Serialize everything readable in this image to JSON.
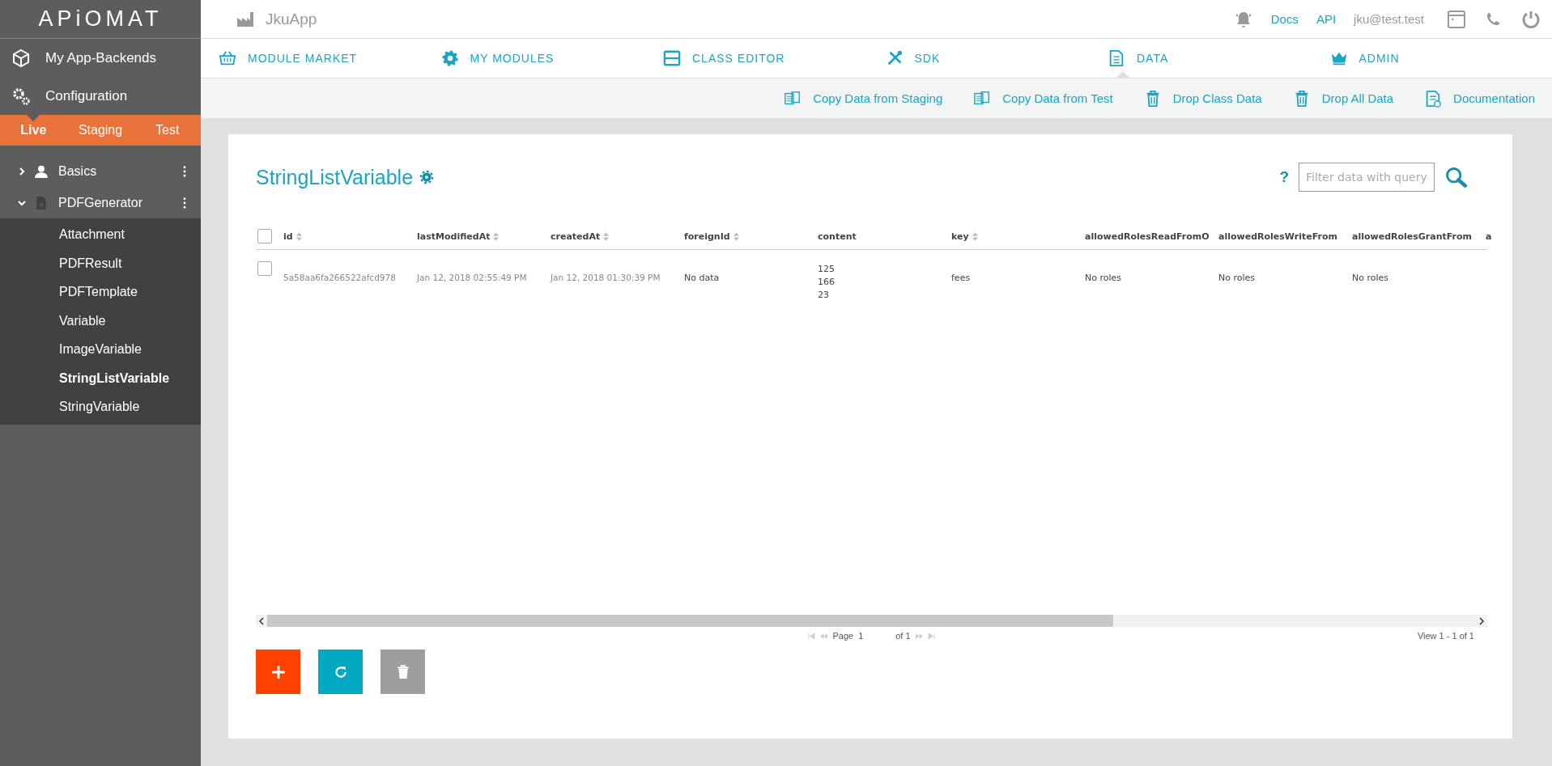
{
  "header": {
    "logo": "APiOMAT",
    "app_name": "JkuApp",
    "links": [
      "Docs",
      "API"
    ],
    "user": "jku@test.test"
  },
  "sidebar": {
    "items": [
      "My App-Backends",
      "Configuration"
    ],
    "environments": [
      {
        "label": "Live",
        "selected": true
      },
      {
        "label": "Staging",
        "selected": false
      },
      {
        "label": "Test",
        "selected": false
      }
    ],
    "modules": [
      {
        "name": "Basics",
        "expanded": false
      },
      {
        "name": "PDFGenerator",
        "expanded": true,
        "children": [
          {
            "name": "Attachment",
            "selected": false
          },
          {
            "name": "PDFResult",
            "selected": false
          },
          {
            "name": "PDFTemplate",
            "selected": false
          },
          {
            "name": "Variable",
            "selected": false
          },
          {
            "name": "ImageVariable",
            "selected": false
          },
          {
            "name": "StringListVariable",
            "selected": true
          },
          {
            "name": "StringVariable",
            "selected": false
          }
        ]
      }
    ]
  },
  "nav_tabs": [
    {
      "label": "MODULE MARKET",
      "selected": false
    },
    {
      "label": "MY MODULES",
      "selected": false
    },
    {
      "label": "CLASS EDITOR",
      "selected": false
    },
    {
      "label": "SDK",
      "selected": false
    },
    {
      "label": "DATA",
      "selected": true
    },
    {
      "label": "ADMIN",
      "selected": false
    }
  ],
  "actions": [
    "Copy Data from Staging",
    "Copy Data from Test",
    "Drop Class Data",
    "Drop All Data",
    "Documentation"
  ],
  "page": {
    "title": "StringListVariable",
    "help": "?",
    "filter": {
      "placeholder": "Filter data with query"
    }
  },
  "table": {
    "all_checked": false,
    "columns": [
      {
        "label": "id",
        "sortable": true
      },
      {
        "label": "lastModifiedAt",
        "sortable": true
      },
      {
        "label": "createdAt",
        "sortable": true
      },
      {
        "label": "foreignId",
        "sortable": true
      },
      {
        "label": "content",
        "sortable": false
      },
      {
        "label": "key",
        "sortable": true
      },
      {
        "label": "allowedRolesReadFromO",
        "sortable": false
      },
      {
        "label": "allowedRolesWriteFrom",
        "sortable": false
      },
      {
        "label": "allowedRolesGrantFrom",
        "sortable": false
      },
      {
        "label": "a",
        "sortable": false
      }
    ],
    "rows": [
      {
        "checked": false,
        "cells": [
          "5a58aa6fa266522afcd978",
          "Jan 12, 2018 02:55:49 PM",
          "Jan 12, 2018 01:30:39 PM",
          "No data",
          [
            "125",
            "166",
            "23"
          ],
          "fees",
          "No roles",
          "No roles",
          "No roles"
        ]
      }
    ]
  },
  "pager": {
    "page_label": "Page",
    "page_value": "1",
    "of_label": "of 1",
    "view": "View 1 - 1 of 1"
  }
}
